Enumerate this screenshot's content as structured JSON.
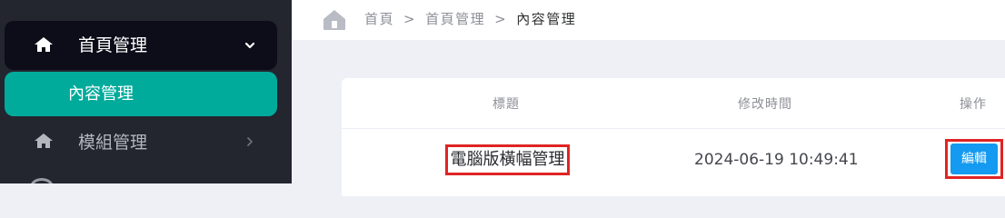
{
  "sidebar": {
    "group_label": "首頁管理",
    "active_item_label": "內容管理",
    "item2_label": "模組管理"
  },
  "breadcrumb": {
    "items": [
      "首頁",
      "首頁管理",
      "內容管理"
    ],
    "separator": ">"
  },
  "table": {
    "headers": {
      "title": "標題",
      "modified": "修改時間",
      "actions": "操作"
    },
    "rows": [
      {
        "title": "電腦版橫幅管理",
        "modified": "2024-06-19 10:49:41",
        "action_label": "編輯"
      }
    ]
  },
  "colors": {
    "sidebar_bg": "#23252f",
    "active_item": "#00ab9c",
    "edit_button": "#149af0",
    "highlight_border": "#e02424"
  }
}
